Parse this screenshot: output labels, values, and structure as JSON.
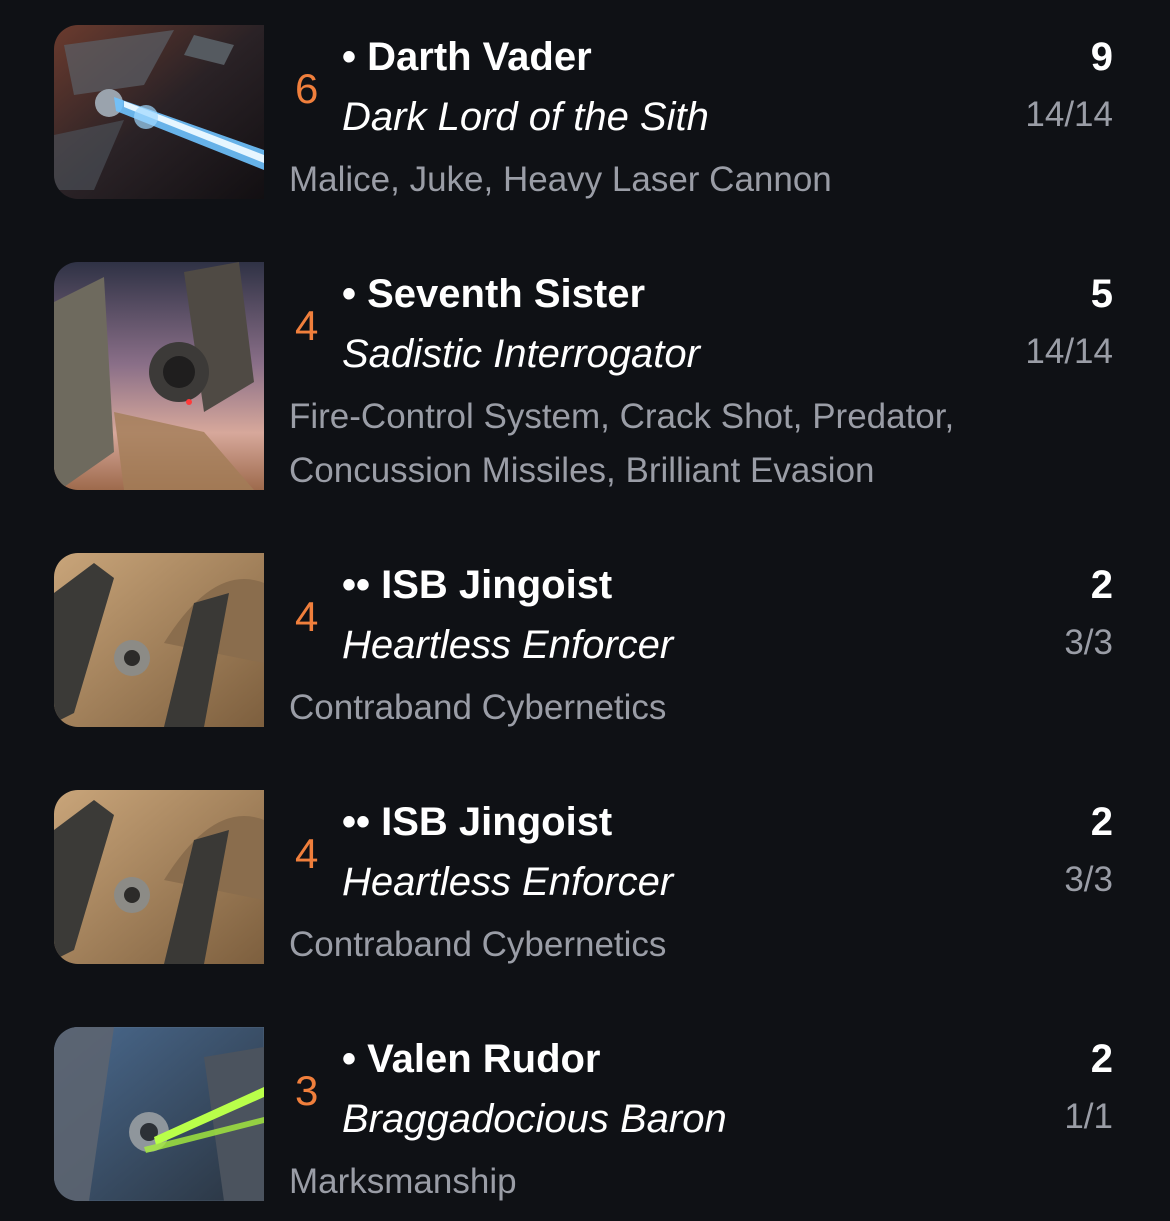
{
  "pilots": [
    {
      "initiative": "6",
      "name": "• Darth Vader",
      "title": "Dark Lord of the Sith",
      "upgrades": "Malice, Juke, Heavy Laser Cannon",
      "cost": "9",
      "points": "14/14",
      "art": "tie-advanced-laser-art"
    },
    {
      "initiative": "4",
      "name": "• Seventh Sister",
      "title": "Sadistic Interrogator",
      "upgrades": "Fire-Control System, Crack Shot, Predator, Concussion Missiles, Brilliant Evasion",
      "cost": "5",
      "points": "14/14",
      "art": "tie-advanced-sunset-art"
    },
    {
      "initiative": "4",
      "name": "•• ISB Jingoist",
      "title": "Heartless Enforcer",
      "upgrades": "Contraband Cybernetics",
      "cost": "2",
      "points": "3/3",
      "art": "tie-fighter-desert-art"
    },
    {
      "initiative": "4",
      "name": "•• ISB Jingoist",
      "title": "Heartless Enforcer",
      "upgrades": "Contraband Cybernetics",
      "cost": "2",
      "points": "3/3",
      "art": "tie-fighter-desert-art"
    },
    {
      "initiative": "3",
      "name": "• Valen Rudor",
      "title": "Braggadocious Baron",
      "upgrades": "Marksmanship",
      "cost": "2",
      "points": "1/1",
      "art": "tie-fighter-green-laser-art"
    }
  ],
  "colors": {
    "background": "#0f1115",
    "initiative": "#f07f3c",
    "primary_text": "#ffffff",
    "secondary_text": "#9a9da6"
  }
}
